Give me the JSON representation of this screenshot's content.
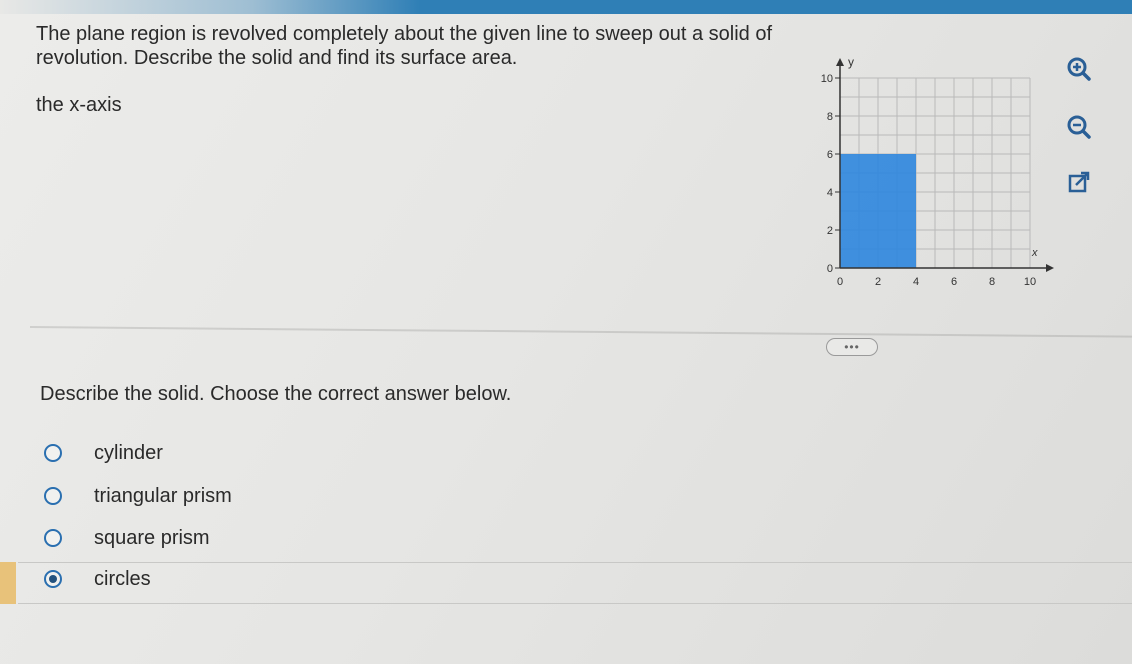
{
  "question": {
    "text": "The plane region is revolved completely about the given line to sweep out a solid of revolution. Describe the solid and find its surface area.",
    "axis": "the x-axis"
  },
  "graph": {
    "y_label": "y",
    "x_label": "x",
    "y_ticks": [
      "0",
      "2",
      "4",
      "6",
      "8",
      "10"
    ],
    "x_ticks": [
      "0",
      "2",
      "4",
      "6",
      "8",
      "10"
    ],
    "region": {
      "x_from": 0,
      "x_to": 4,
      "y_from": 0,
      "y_to": 6
    },
    "region_color": "#2e86de"
  },
  "tools": {
    "zoom_in": "zoom-in-icon",
    "zoom_out": "zoom-out-icon",
    "popout": "popout-icon"
  },
  "more_label": "•••",
  "prompt": "Describe the solid. Choose the correct answer below.",
  "options": [
    {
      "label": "cylinder",
      "selected": false
    },
    {
      "label": "triangular prism",
      "selected": false
    },
    {
      "label": "square prism",
      "selected": false
    },
    {
      "label": "circles",
      "selected": true
    }
  ]
}
